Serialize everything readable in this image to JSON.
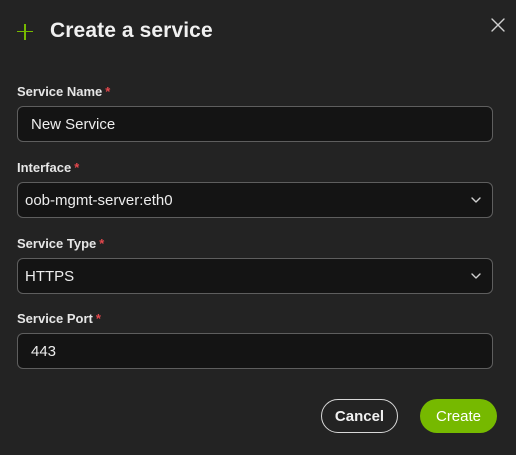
{
  "dialog": {
    "title": "Create a service",
    "close_icon": "close-icon",
    "header_icon": "plus-icon"
  },
  "fields": {
    "service_name": {
      "label": "Service Name",
      "required": "*",
      "value": "New Service"
    },
    "interface": {
      "label": "Interface",
      "required": "*",
      "value": "oob-mgmt-server:eth0"
    },
    "service_type": {
      "label": "Service Type",
      "required": "*",
      "value": "HTTPS"
    },
    "service_port": {
      "label": "Service Port",
      "required": "*",
      "value": "443"
    }
  },
  "actions": {
    "cancel_label": "Cancel",
    "create_label": "Create"
  },
  "colors": {
    "accent": "#76b900",
    "required": "#e5484d",
    "background": "#232323",
    "input_background": "#141414"
  }
}
